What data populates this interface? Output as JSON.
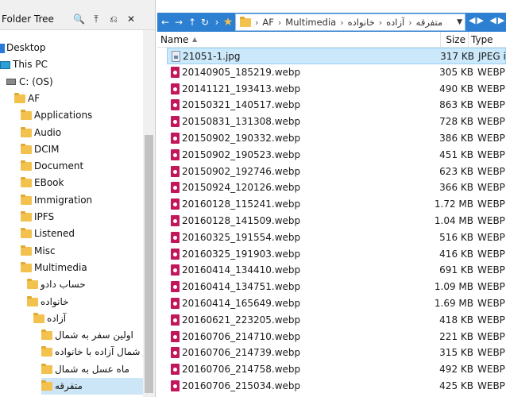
{
  "tree": {
    "title": "Folder Tree",
    "tools": {
      "search": "🔍",
      "up": "⤒",
      "new": "⎌",
      "close": "✕"
    },
    "nodes": [
      {
        "label": "Desktop",
        "icon": "desktop-icon"
      },
      {
        "label": "This PC",
        "icon": "pc-icon"
      },
      {
        "label": "C: (OS)",
        "icon": "drive-icon"
      },
      {
        "label": "AF",
        "icon": "folder-icon"
      },
      {
        "label": "Applications",
        "icon": "folder-icon"
      },
      {
        "label": "Audio",
        "icon": "folder-icon"
      },
      {
        "label": "DCIM",
        "icon": "folder-icon"
      },
      {
        "label": "Document",
        "icon": "folder-icon"
      },
      {
        "label": "EBook",
        "icon": "folder-icon"
      },
      {
        "label": "Immigration",
        "icon": "folder-icon"
      },
      {
        "label": "IPFS",
        "icon": "folder-icon"
      },
      {
        "label": "Listened",
        "icon": "folder-icon"
      },
      {
        "label": "Misc",
        "icon": "folder-icon"
      },
      {
        "label": "Multimedia",
        "icon": "folder-icon"
      },
      {
        "label": "حساب دادو",
        "icon": "folder-icon"
      },
      {
        "label": "خانواده",
        "icon": "folder-icon"
      },
      {
        "label": "آزاده",
        "icon": "folder-icon"
      },
      {
        "label": "اولین سفر به شمال",
        "icon": "folder-icon"
      },
      {
        "label": "سفر شمال آزاده با خانواده",
        "icon": "folder-icon"
      },
      {
        "label": "ماه عسل به شمال",
        "icon": "folder-icon"
      },
      {
        "label": "متفرقه",
        "icon": "folder-icon"
      }
    ]
  },
  "address": {
    "back": "←",
    "forward": "→",
    "up": "↑",
    "refresh": "↻",
    "chevron": "›",
    "star": "★",
    "crumbs": [
      "AF",
      "Multimedia",
      "خانواده",
      "آزاده",
      "متفرقه"
    ],
    "dropdown": "▼",
    "right_controls": "◀▶ ◀▶"
  },
  "columns": {
    "name": "Name",
    "size": "Size",
    "type": "Type"
  },
  "files": [
    {
      "name": "21051-1.jpg",
      "size": "317 KB",
      "type": "JPEG im",
      "kind": "jpg"
    },
    {
      "name": "20140905_185219.webp",
      "size": "305 KB",
      "type": "WEBP Ir",
      "kind": "webp"
    },
    {
      "name": "20141121_193413.webp",
      "size": "490 KB",
      "type": "WEBP Ir",
      "kind": "webp"
    },
    {
      "name": "20150321_140517.webp",
      "size": "863 KB",
      "type": "WEBP Ir",
      "kind": "webp"
    },
    {
      "name": "20150831_131308.webp",
      "size": "728 KB",
      "type": "WEBP Ir",
      "kind": "webp"
    },
    {
      "name": "20150902_190332.webp",
      "size": "386 KB",
      "type": "WEBP Ir",
      "kind": "webp"
    },
    {
      "name": "20150902_190523.webp",
      "size": "451 KB",
      "type": "WEBP Ir",
      "kind": "webp"
    },
    {
      "name": "20150902_192746.webp",
      "size": "623 KB",
      "type": "WEBP Ir",
      "kind": "webp"
    },
    {
      "name": "20150924_120126.webp",
      "size": "366 KB",
      "type": "WEBP Ir",
      "kind": "webp"
    },
    {
      "name": "20160128_115241.webp",
      "size": "1.72 MB",
      "type": "WEBP Ir",
      "kind": "webp"
    },
    {
      "name": "20160128_141509.webp",
      "size": "1.04 MB",
      "type": "WEBP Ir",
      "kind": "webp"
    },
    {
      "name": "20160325_191554.webp",
      "size": "516 KB",
      "type": "WEBP Ir",
      "kind": "webp"
    },
    {
      "name": "20160325_191903.webp",
      "size": "416 KB",
      "type": "WEBP Ir",
      "kind": "webp"
    },
    {
      "name": "20160414_134410.webp",
      "size": "691 KB",
      "type": "WEBP Ir",
      "kind": "webp"
    },
    {
      "name": "20160414_134751.webp",
      "size": "1.09 MB",
      "type": "WEBP Ir",
      "kind": "webp"
    },
    {
      "name": "20160414_165649.webp",
      "size": "1.69 MB",
      "type": "WEBP Ir",
      "kind": "webp"
    },
    {
      "name": "20160621_223205.webp",
      "size": "418 KB",
      "type": "WEBP Ir",
      "kind": "webp"
    },
    {
      "name": "20160706_214710.webp",
      "size": "221 KB",
      "type": "WEBP Ir",
      "kind": "webp"
    },
    {
      "name": "20160706_214739.webp",
      "size": "315 KB",
      "type": "WEBP Ir",
      "kind": "webp"
    },
    {
      "name": "20160706_214758.webp",
      "size": "492 KB",
      "type": "WEBP Ir",
      "kind": "webp"
    },
    {
      "name": "20160706_215034.webp",
      "size": "425 KB",
      "type": "WEBP Ir",
      "kind": "webp"
    }
  ]
}
